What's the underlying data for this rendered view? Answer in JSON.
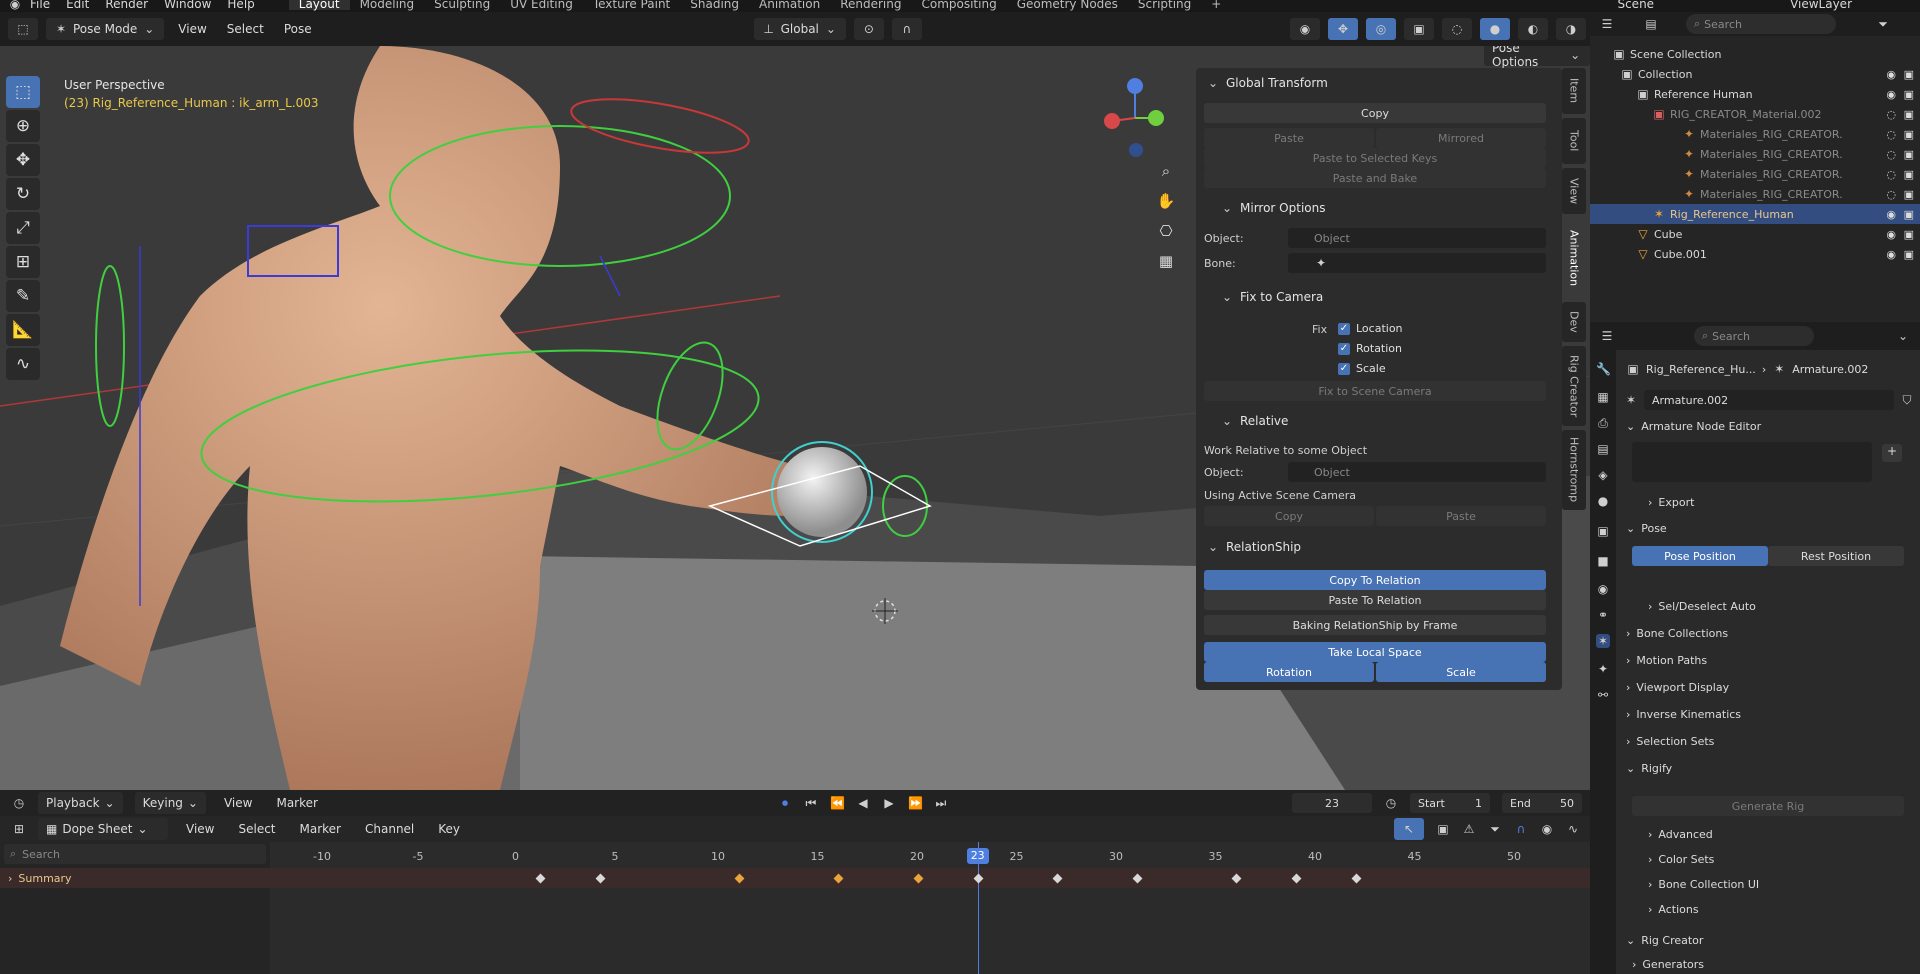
{
  "menu": [
    "File",
    "Edit",
    "Render",
    "Window",
    "Help"
  ],
  "workspaces": [
    "Layout",
    "Modeling",
    "Sculpting",
    "UV Editing",
    "Texture Paint",
    "Shading",
    "Animation",
    "Rendering",
    "Compositing",
    "Geometry Nodes",
    "Scripting",
    "+"
  ],
  "active_workspace": "Layout",
  "scene_label": "Scene",
  "viewlayer_label": "ViewLayer",
  "viewport_header": {
    "mode": "Pose Mode",
    "menus": [
      "View",
      "Select",
      "Pose"
    ],
    "orientation": "Global",
    "pose_options": "Pose Options"
  },
  "viewport": {
    "perspective": "User Perspective",
    "active_info": "(23) Rig_Reference_Human : ik_arm_L.003"
  },
  "npanel": {
    "global_transform": "Global Transform",
    "copy": "Copy",
    "paste": "Paste",
    "mirrored": "Mirrored",
    "paste_selected_keys": "Paste to Selected Keys",
    "paste_and_bake": "Paste and Bake",
    "mirror_options": "Mirror Options",
    "object_label": "Object:",
    "bone_label": "Bone:",
    "object_placeholder": "Object",
    "fix_to_camera": "Fix to Camera",
    "fix_label": "Fix",
    "fix_location": "Location",
    "fix_rotation": "Rotation",
    "fix_scale": "Scale",
    "fix_to_scene_camera": "Fix to Scene Camera",
    "relative": "Relative",
    "work_relative": "Work Relative to some Object",
    "using_active_camera": "Using Active Scene Camera",
    "rel_copy": "Copy",
    "rel_paste": "Paste",
    "relationship": "RelationShip",
    "copy_to_relation": "Copy To Relation",
    "paste_to_relation": "Paste To Relation",
    "baking_relationship": "Baking RelationShip by Frame",
    "take_local_space": "Take Local Space",
    "rotation": "Rotation",
    "scale": "Scale"
  },
  "side_tabs": [
    "Item",
    "Tool",
    "View",
    "Animation",
    "Dev",
    "Rig Creator",
    "Hornstromp"
  ],
  "outliner": {
    "search_placeholder": "Search",
    "rows": [
      {
        "label": "Scene Collection",
        "indent": 0
      },
      {
        "label": "Collection",
        "indent": 1
      },
      {
        "label": "Reference Human",
        "indent": 2
      },
      {
        "label": "RIG_CREATOR_Material.002",
        "indent": 3,
        "dim": true
      },
      {
        "label": "Materiales_RIG_CREATOR.",
        "indent": 4,
        "dim": true
      },
      {
        "label": "Materiales_RIG_CREATOR.",
        "indent": 4,
        "dim": true
      },
      {
        "label": "Materiales_RIG_CREATOR.",
        "indent": 4,
        "dim": true
      },
      {
        "label": "Materiales_RIG_CREATOR.",
        "indent": 4,
        "dim": true
      },
      {
        "label": "Rig_Reference_Human",
        "indent": 3,
        "selected": true
      },
      {
        "label": "Cube",
        "indent": 2
      },
      {
        "label": "Cube.001",
        "indent": 2
      }
    ]
  },
  "properties": {
    "search_placeholder": "Search",
    "breadcrumb_object": "Rig_Reference_Hu...",
    "breadcrumb_data": "Armature.002",
    "data_name": "Armature.002",
    "armature_node_editor": "Armature Node Editor",
    "export": "Export",
    "pose": "Pose",
    "pose_position": "Pose Position",
    "rest_position": "Rest Position",
    "sel_deselect_auto": "Sel/Deselect Auto",
    "bone_collections": "Bone Collections",
    "motion_paths": "Motion Paths",
    "viewport_display": "Viewport Display",
    "inverse_kinematics": "Inverse Kinematics",
    "selection_sets": "Selection Sets",
    "rigify": "Rigify",
    "generate_rig": "Generate Rig",
    "advanced": "Advanced",
    "color_sets": "Color Sets",
    "bone_collection_ui": "Bone Collection UI",
    "actions": "Actions",
    "rig_creator": "Rig Creator",
    "generators": "Generators"
  },
  "timeline": {
    "menus": [
      "Playback",
      "Keying",
      "View",
      "Marker"
    ],
    "current_frame": "23",
    "start_label": "Start",
    "start": "1",
    "end_label": "End",
    "end": "50"
  },
  "dopesheet": {
    "mode": "Dope Sheet",
    "menus": [
      "View",
      "Select",
      "Marker",
      "Channel",
      "Key"
    ],
    "search_placeholder": "Search",
    "summary": "Summary",
    "ticks": [
      "-10",
      "-5",
      "0",
      "5",
      "10",
      "15",
      "20",
      "23",
      "25",
      "30",
      "35",
      "40",
      "45",
      "50"
    ],
    "current_frame": "23",
    "keyframes": [
      {
        "frame": 1,
        "color": "white"
      },
      {
        "frame": 4,
        "color": "white"
      },
      {
        "frame": 11,
        "color": "orange"
      },
      {
        "frame": 16,
        "color": "orange"
      },
      {
        "frame": 20,
        "color": "orange"
      },
      {
        "frame": 23,
        "color": "white"
      },
      {
        "frame": 27,
        "color": "white"
      },
      {
        "frame": 31,
        "color": "white"
      },
      {
        "frame": 36,
        "color": "white"
      },
      {
        "frame": 39,
        "color": "white"
      },
      {
        "frame": 42,
        "color": "white"
      }
    ]
  },
  "colors": {
    "accent": "#4772b3",
    "selection": "#334d80",
    "keyframe_selected": "#e8a53a"
  }
}
